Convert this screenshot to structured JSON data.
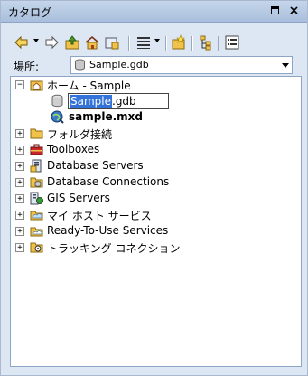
{
  "window": {
    "title": "カタログ",
    "close_glyph": "×"
  },
  "toolbar": {
    "icons": [
      "back-arrow-icon",
      "dropdown-icon",
      "forward-arrow-icon",
      "up-folder-icon",
      "home-icon",
      "connect-folder-icon",
      "view-options-icon",
      "dropdown-icon",
      "new-item-icon",
      "tree-view-icon",
      "properties-icon"
    ]
  },
  "location": {
    "label": "場所:",
    "value": "Sample.gdb"
  },
  "tree": {
    "home": {
      "label": "ホーム - Sample",
      "expander": "−"
    },
    "gdb_edit": {
      "selected": "Sample",
      "rest": ".gdb"
    },
    "mxd": {
      "label": "sample.mxd"
    },
    "items": [
      {
        "label": "フォルダ接続",
        "expander": "+"
      },
      {
        "label": "Toolboxes",
        "expander": "+"
      },
      {
        "label": "Database Servers",
        "expander": "+"
      },
      {
        "label": "Database Connections",
        "expander": "+"
      },
      {
        "label": "GIS Servers",
        "expander": "+"
      },
      {
        "label": "マイ ホスト サービス",
        "expander": "+"
      },
      {
        "label": "Ready-To-Use Services",
        "expander": "+"
      },
      {
        "label": "トラッキング コネクション",
        "expander": "+"
      }
    ]
  },
  "colors": {
    "selection": "#3372d8",
    "frame": "#dde6f3",
    "folder": "#f1c24a"
  }
}
